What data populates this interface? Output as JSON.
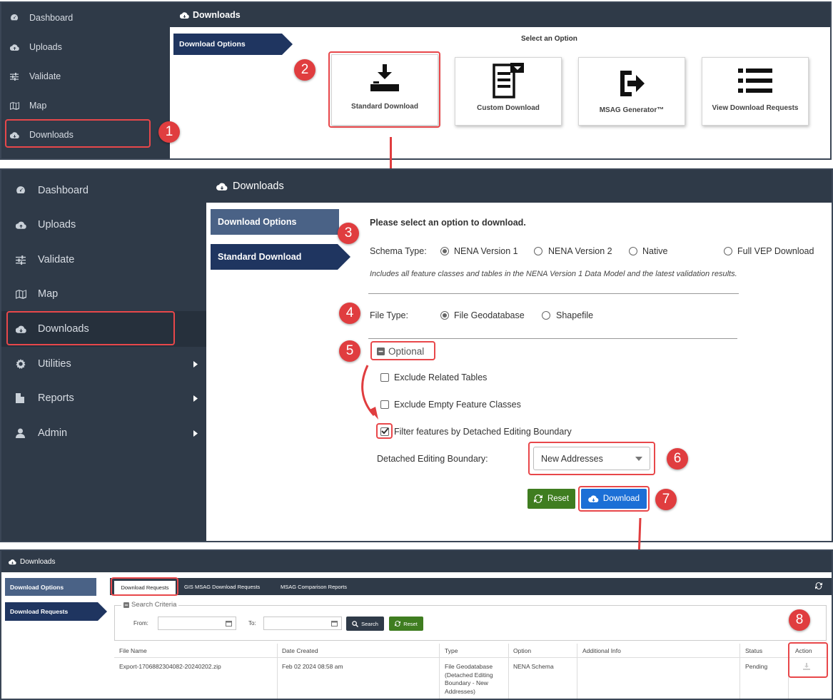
{
  "panel1": {
    "header_title": "Downloads",
    "sidebar": [
      "Dashboard",
      "Uploads",
      "Validate",
      "Map",
      "Downloads"
    ],
    "tab_download_options": "Download Options",
    "select_option_title": "Select an Option",
    "cards": [
      "Standard Download",
      "Custom Download",
      "MSAG Generator™",
      "View Download Requests"
    ],
    "badges": [
      "1",
      "2"
    ]
  },
  "panel2": {
    "header_title": "Downloads",
    "sidebar": [
      "Dashboard",
      "Uploads",
      "Validate",
      "Map",
      "Downloads",
      "Utilities",
      "Reports",
      "Admin"
    ],
    "tab_download_options": "Download Options",
    "tab_standard_download": "Standard Download",
    "prompt": "Please select an option to download.",
    "schema_label": "Schema Type:",
    "schema_options": [
      "NENA Version 1",
      "NENA Version 2",
      "Native",
      "Full VEP Download"
    ],
    "schema_selected": "NENA Version 1",
    "schema_desc": "Includes all feature classes and tables in the NENA Version 1 Data Model and the latest validation results.",
    "file_type_label": "File Type:",
    "file_type_options": [
      "File Geodatabase",
      "Shapefile"
    ],
    "optional_label": "Optional",
    "checkboxes": [
      {
        "label": "Exclude Related Tables",
        "checked": false
      },
      {
        "label": "Exclude Empty Feature Classes",
        "checked": false
      },
      {
        "label": "Filter features by Detached Editing Boundary",
        "checked": true
      }
    ],
    "boundary_label": "Detached Editing Boundary:",
    "boundary_value": "New Addresses",
    "reset_label": "Reset",
    "download_label": "Download",
    "badges": [
      "3",
      "4",
      "5",
      "6",
      "7"
    ]
  },
  "panel3": {
    "header_title": "Downloads",
    "tab_download_options": "Download Options",
    "tab_download_requests": "Download Requests",
    "subtabs": [
      "Download Requests",
      "GIS MSAG Download Requests",
      "MSAG Comparison Reports"
    ],
    "search_criteria_label": "Search Criteria",
    "from_label": "From:",
    "to_label": "To:",
    "search_label": "Search",
    "reset_label": "Reset",
    "columns": [
      "File Name",
      "Date Created",
      "Type",
      "Option",
      "Additional Info",
      "Status",
      "Action"
    ],
    "row": {
      "file_name": "Export-1706882304082-20240202.zip",
      "date_created": "Feb 02 2024 08:58 am",
      "type": "File Geodatabase (Detached Editing Boundary - New Addresses)",
      "option": "NENA Schema",
      "additional_info": "",
      "status": "Pending"
    },
    "badge": "8"
  },
  "colors": {
    "sidebar": "#2f3a48",
    "tab_dark": "#1f3560",
    "highlight": "#e8474a",
    "download_btn": "#1b6fd6",
    "reset_btn": "#3f7d20"
  }
}
